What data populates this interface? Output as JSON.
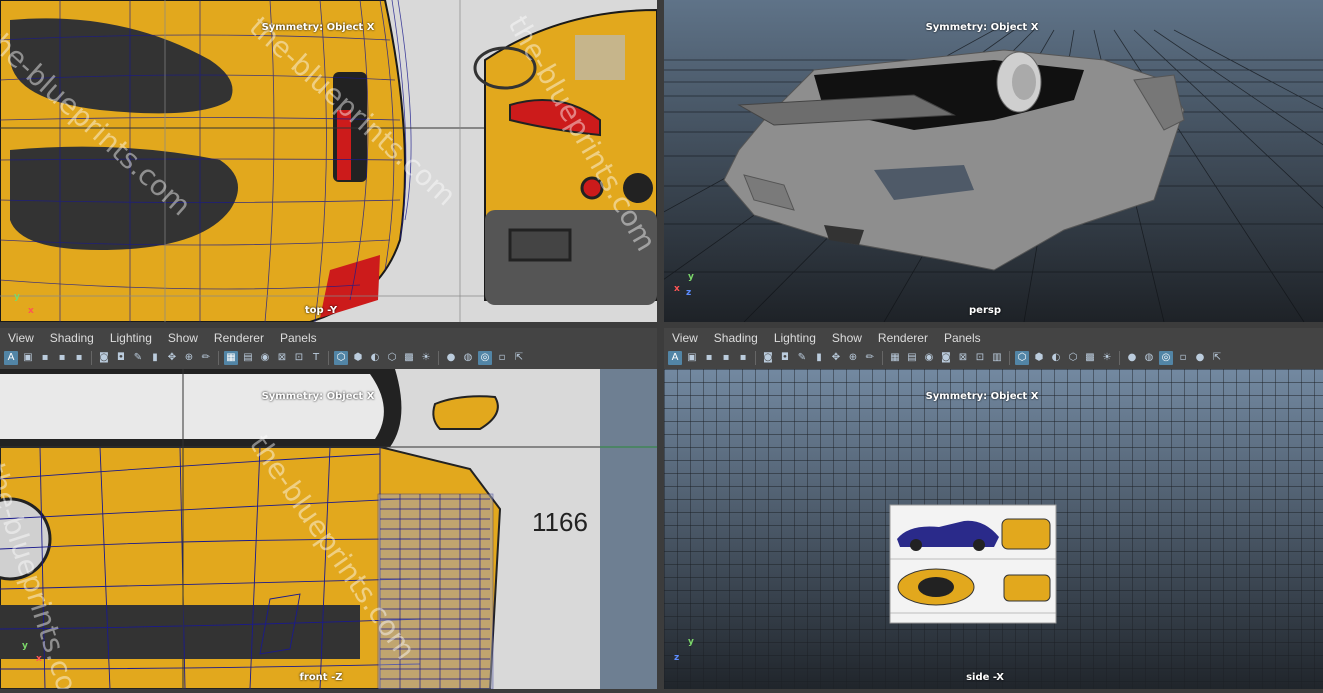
{
  "viewports": {
    "top": {
      "symmetry": "Symmetry: Object X",
      "camera": "top -Y",
      "watermark": "the-blueprints.com"
    },
    "persp": {
      "symmetry": "Symmetry: Object X",
      "camera": "persp"
    },
    "front": {
      "symmetry": "Symmetry: Object X",
      "camera": "front -Z",
      "watermark": "the-blueprints.com",
      "dimension": "1166"
    },
    "side": {
      "symmetry": "Symmetry: Object X",
      "camera": "side -X"
    }
  },
  "panel_menu": [
    "View",
    "Shading",
    "Lighting",
    "Show",
    "Renderer",
    "Panels"
  ],
  "toolbar_icons": [
    "select-camera-icon",
    "camera-attributes-icon",
    "bookmark-icon",
    "image-plane-icon",
    "two-d-pan-icon",
    "grease-pencil-icon",
    "grid-icon",
    "film-gate-icon",
    "resolution-gate-icon",
    "gate-mask-icon",
    "field-chart-icon",
    "safe-action-icon",
    "safe-title-icon",
    "wireframe-icon",
    "smooth-shade-icon",
    "use-default-material-icon",
    "wireframe-on-shaded-icon",
    "textured-icon",
    "use-all-lights-icon",
    "shadows-icon",
    "screen-space-ao-icon",
    "motion-blur-icon",
    "multisample-aa-icon",
    "depth-of-field-icon",
    "isolate-select-icon",
    "xray-icon",
    "xray-joints-icon"
  ],
  "axis_labels": {
    "x": "x",
    "y": "y",
    "z": "z"
  },
  "colors": {
    "panel_bg": "#444444",
    "toolbar_active": "#5285a6",
    "viewport_grad_top": "#6d8299",
    "viewport_grad_bottom": "#1f2328",
    "car_yellow": "#e2a81d",
    "wire_blue": "#1a1a8c"
  }
}
